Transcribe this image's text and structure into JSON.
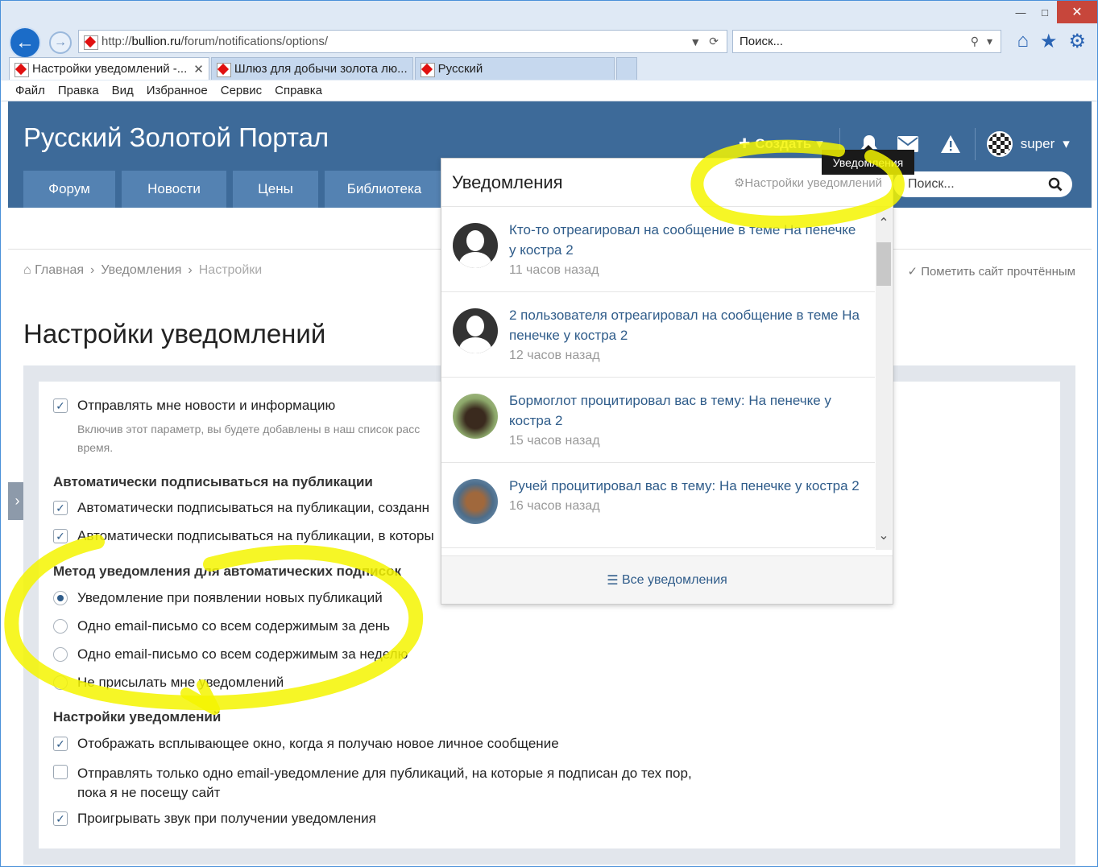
{
  "browser": {
    "url_prefix": "http://",
    "url_domain": "bullion.ru",
    "url_path": "/forum/notifications/options/",
    "search_placeholder": "Поиск...",
    "tabs": [
      {
        "label": "Настройки уведомлений -...",
        "close": "✕"
      },
      {
        "label": "Шлюз для добычи золота лю..."
      },
      {
        "label": "Русский"
      }
    ],
    "menu": [
      "Файл",
      "Правка",
      "Вид",
      "Избранное",
      "Сервис",
      "Справка"
    ]
  },
  "site": {
    "title": "Русский Золотой Портал",
    "create_label": "Создать",
    "username": "super",
    "nav": [
      "Форум",
      "Новости",
      "Цены",
      "Библиотека"
    ],
    "search_placeholder": "Поиск...",
    "tooltip": "Уведомления"
  },
  "breadcrumb": {
    "home": "Главная",
    "notifications": "Уведомления",
    "current": "Настройки",
    "mark_read": "Пометить сайт прочтённым"
  },
  "page": {
    "title": "Настройки уведомлений",
    "news_option": "Отправлять мне новости и информацию",
    "news_hint_1": "Включив этот параметр, вы будете добавлены в наш список расс",
    "news_hint_2": "время.",
    "auto_section": "Автоматически подписываться на публикации",
    "auto_opt1": "Автоматически подписываться на публикации, созданн",
    "auto_opt2": "Автоматически подписываться на публикации, в которы",
    "method_section": "Метод уведомления для автоматических подписок",
    "method_opt1": "Уведомление при появлении новых публикаций",
    "method_opt2": "Одно email-письмо со всем содержимым за день",
    "method_opt3": "Одно email-письмо со всем содержимым за неделю",
    "method_opt4": "Не присылать мне уведомлений",
    "settings_section": "Настройки уведомлений",
    "set_opt1": "Отображать всплывающее окно, когда я получаю новое личное сообщение",
    "set_opt2_l1": "Отправлять только одно email-уведомление для публикаций, на которые я подписан до тех пор,",
    "set_opt2_l2": "пока я не посещу сайт",
    "set_opt3": "Проигрывать звук при получении уведомления"
  },
  "dropdown": {
    "title": "Уведомления",
    "settings": "Настройки уведомлений",
    "items": [
      {
        "text": "Кто-то отреагировал на сообщение в теме На пенечке у костра 2",
        "time": "11 часов назад"
      },
      {
        "text": "2 пользователя отреагировал на сообщение в теме На пенечке у костра 2",
        "time": "12 часов назад"
      },
      {
        "text": "Бормоглот процитировал вас в тему: На пенечке у костра 2",
        "time": "15 часов назад"
      },
      {
        "text": "Ручей процитировал вас в тему: На пенечке у костра 2",
        "time": "16 часов назад"
      }
    ],
    "all": "Все уведомления"
  },
  "colors": {
    "header": "#3d6a99",
    "nav_tab": "#5482b2",
    "link": "#2f5c8a",
    "marker": "#f4f400"
  }
}
